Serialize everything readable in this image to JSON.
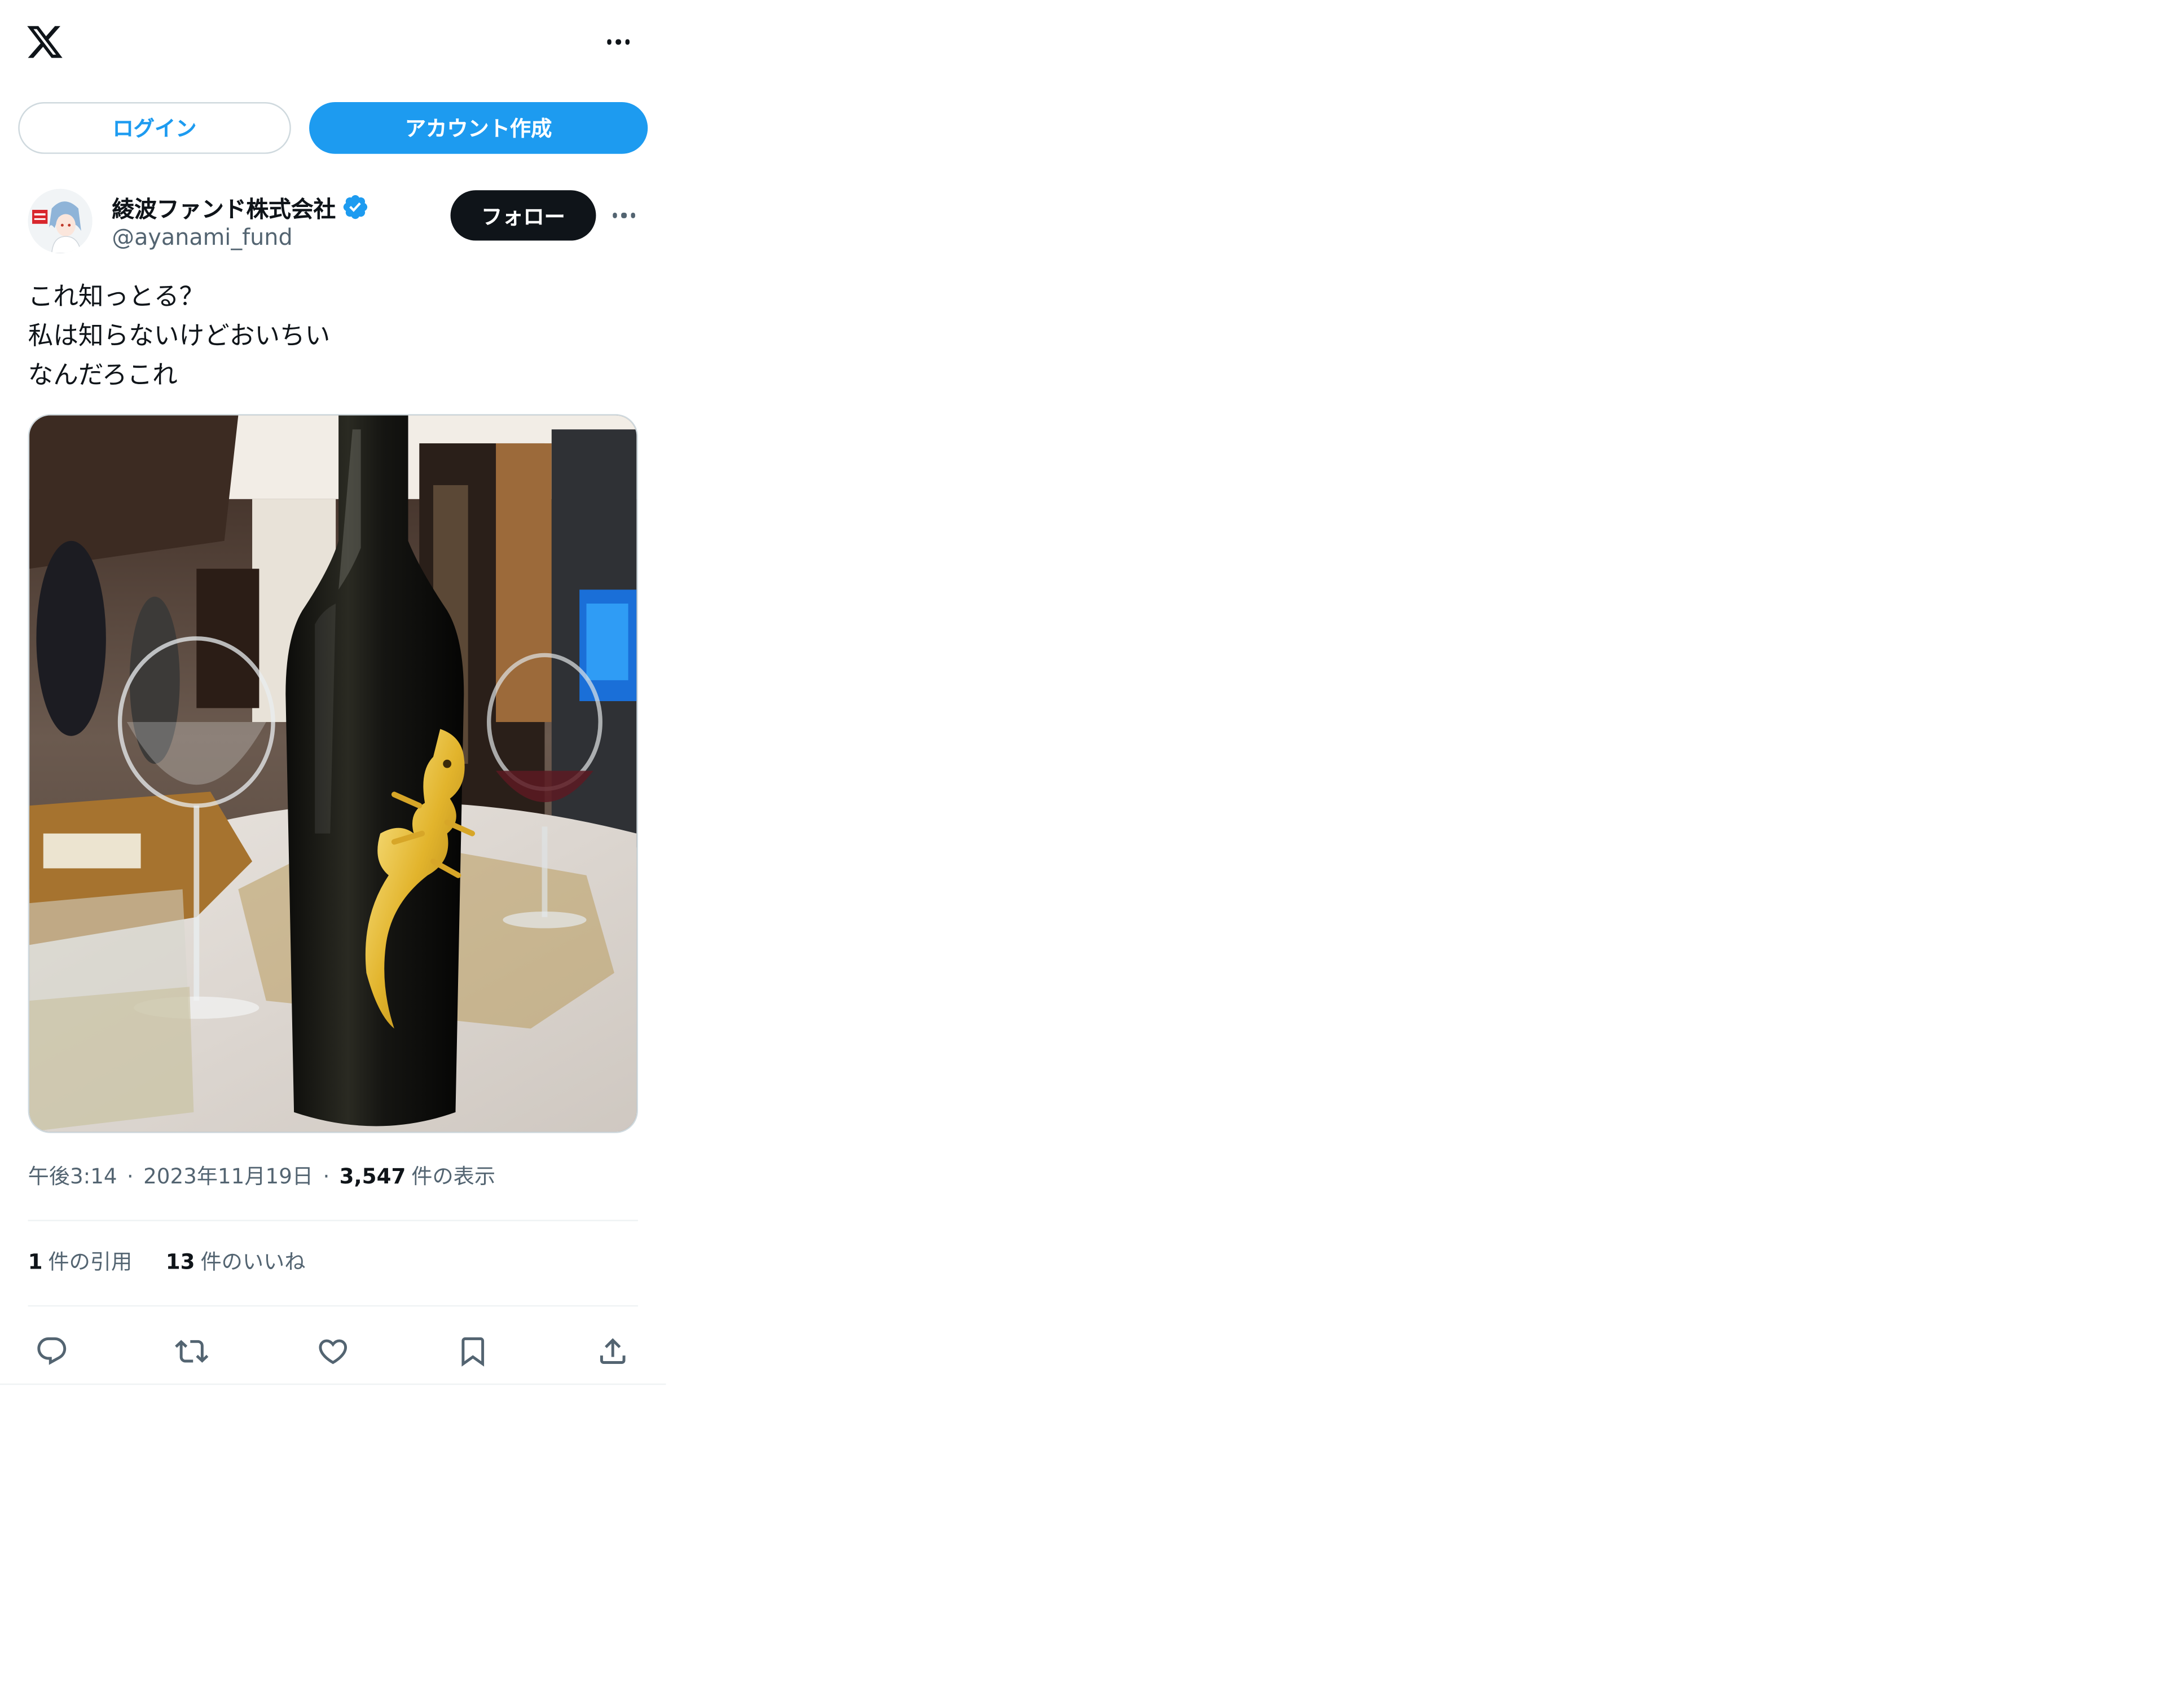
{
  "header": {
    "logo_icon": "x-logo-icon",
    "more_icon": "more-horizontal-icon"
  },
  "auth": {
    "login_label": "ログイン",
    "signup_label": "アカウント作成"
  },
  "tweet": {
    "author": {
      "display_name": "綾波ファンド株式会社",
      "handle": "@ayanami_fund",
      "verified_icon": "verified-badge-icon"
    },
    "follow_label": "フォロー",
    "text_lines": [
      "これ知っとる？",
      "私は知らないけどおいちい",
      "なんだろこれ"
    ],
    "image": "photo of a dark wine bottle with a gold crocodile emblem on a dining table",
    "time": "午後3:14",
    "date": "2023年11月19日",
    "views_count": "3,547",
    "views_label": "件の表示",
    "separator": "·",
    "quotes_count": "1",
    "quotes_label": "件の引用",
    "likes_count": "13",
    "likes_label": "件のいいね"
  },
  "actions": {
    "reply_icon": "reply-icon",
    "retweet_icon": "retweet-icon",
    "like_icon": "heart-icon",
    "bookmark_icon": "bookmark-icon",
    "share_icon": "share-icon"
  },
  "colors": {
    "accent": "#1d9bf0",
    "text": "#0f1419",
    "secondary_text": "#536471",
    "border": "#cfd9de"
  }
}
